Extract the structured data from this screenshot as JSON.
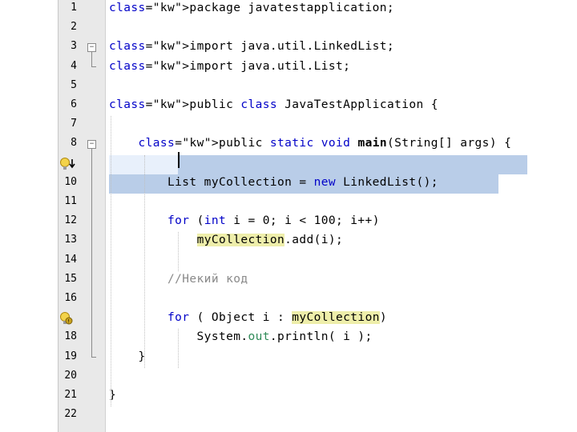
{
  "editor": {
    "lines": [
      {
        "n": "1",
        "code": "package javatestapplication;"
      },
      {
        "n": "2",
        "code": ""
      },
      {
        "n": "3",
        "code": "import java.util.LinkedList;"
      },
      {
        "n": "4",
        "code": "import java.util.List;"
      },
      {
        "n": "5",
        "code": ""
      },
      {
        "n": "6",
        "code": "public class JavaTestApplication {"
      },
      {
        "n": "7",
        "code": ""
      },
      {
        "n": "8",
        "code": "    public static void main(String[] args) {"
      },
      {
        "n": "",
        "code": ""
      },
      {
        "n": "10",
        "code": "        List myCollection = new LinkedList();"
      },
      {
        "n": "11",
        "code": ""
      },
      {
        "n": "12",
        "code": "        for (int i = 0; i < 100; i++)"
      },
      {
        "n": "13",
        "code": "            myCollection.add(i);"
      },
      {
        "n": "14",
        "code": ""
      },
      {
        "n": "15",
        "code": "        //Некий код"
      },
      {
        "n": "16",
        "code": ""
      },
      {
        "n": "",
        "code": "        for ( Object i : myCollection)"
      },
      {
        "n": "18",
        "code": "            System.out.println( i );"
      },
      {
        "n": "19",
        "code": "    }"
      },
      {
        "n": "20",
        "code": ""
      },
      {
        "n": "21",
        "code": "}"
      },
      {
        "n": "22",
        "code": ""
      }
    ],
    "gutter_icons": [
      {
        "line": 9,
        "name": "bulb-hint-icon"
      },
      {
        "line": 17,
        "name": "bulb-warning-icon"
      }
    ],
    "colors": {
      "keyword": "#0000c8",
      "comment": "#8a8a8a",
      "field": "#2e8a57",
      "occurrence_highlight": "#eeeeaa",
      "selection": "#b9cde8",
      "current_line": "#e8f0fb",
      "gutter": "#e9e9e9"
    }
  }
}
